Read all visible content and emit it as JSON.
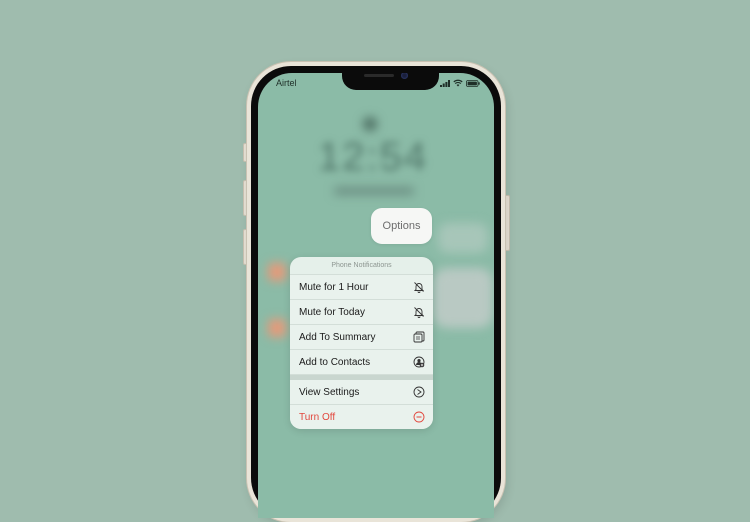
{
  "background_color": "#9fbcae",
  "status_bar": {
    "carrier": "Airtel",
    "icons": [
      "signal-icon",
      "wifi-icon",
      "battery-icon"
    ]
  },
  "lock_screen": {
    "time": "12:54",
    "blurred": true
  },
  "options_button": {
    "label": "Options"
  },
  "context_menu": {
    "header": "Phone Notifications",
    "items": [
      {
        "label": "Mute for 1 Hour",
        "icon": "bell-slash-icon"
      },
      {
        "label": "Mute for Today",
        "icon": "bell-slash-icon"
      },
      {
        "label": "Add To Summary",
        "icon": "summary-icon"
      },
      {
        "label": "Add to Contacts",
        "icon": "add-contact-icon"
      },
      {
        "label": "View Settings",
        "icon": "settings-arrow-icon"
      },
      {
        "label": "Turn Off",
        "icon": "minus-circle-icon",
        "destructive": true,
        "color": "#e2473d"
      }
    ]
  }
}
